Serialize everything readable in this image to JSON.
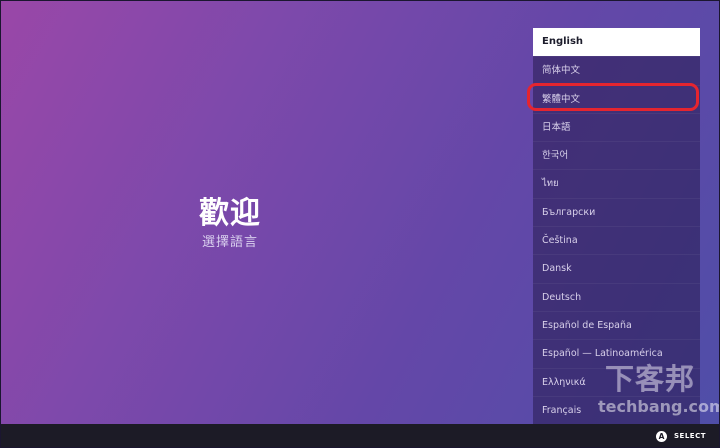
{
  "welcome": {
    "title": "歡迎",
    "subtitle": "選擇語言"
  },
  "language_list": {
    "selected_index": 0,
    "highlighted_index": 2,
    "highlight_color": "#e5252f",
    "items": [
      {
        "label": "English"
      },
      {
        "label": "简体中文"
      },
      {
        "label": "繁體中文"
      },
      {
        "label": "日本語"
      },
      {
        "label": "한국어"
      },
      {
        "label": "ไทย"
      },
      {
        "label": "Български"
      },
      {
        "label": "Čeština"
      },
      {
        "label": "Dansk"
      },
      {
        "label": "Deutsch"
      },
      {
        "label": "Español de España"
      },
      {
        "label": "Español — Latinoamérica"
      },
      {
        "label": "Ελληνικά"
      },
      {
        "label": "Français"
      }
    ]
  },
  "bottom_bar": {
    "button_glyph": "A",
    "select_label": "SELECT"
  },
  "watermark": {
    "cjk": "下客邦",
    "latin": "techbang.com"
  }
}
